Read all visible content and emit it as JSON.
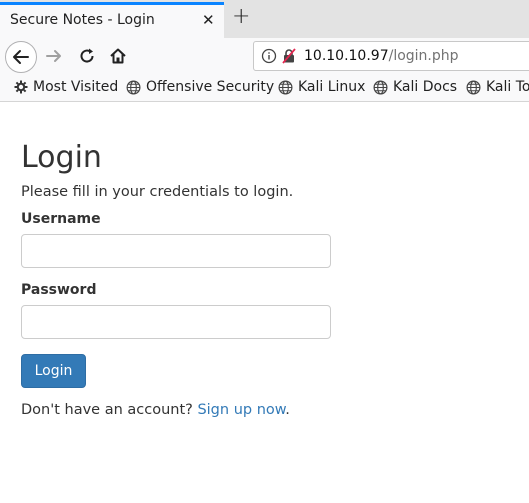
{
  "browser": {
    "tab": {
      "title": "Secure Notes - Login",
      "close_label": "✕"
    },
    "new_tab_label": "+",
    "url": {
      "host": "10.10.10.97",
      "path": "/login.php"
    },
    "bookmarks": [
      {
        "label": "Most Visited",
        "icon": "gear-icon"
      },
      {
        "label": "Offensive Security",
        "icon": "globe-icon"
      },
      {
        "label": "Kali Linux",
        "icon": "globe-icon"
      },
      {
        "label": "Kali Docs",
        "icon": "globe-icon"
      },
      {
        "label": "Kali Tools",
        "icon": "globe-icon"
      }
    ]
  },
  "page": {
    "title": "Login",
    "description": "Please fill in your credentials to login.",
    "username_label": "Username",
    "username_value": "",
    "password_label": "Password",
    "password_value": "",
    "login_button": "Login",
    "signup_prompt": "Don't have an account? ",
    "signup_link": "Sign up now",
    "signup_suffix": "."
  },
  "colors": {
    "accent": "#0a84ff",
    "button": "#337ab7",
    "link": "#337ab7"
  }
}
